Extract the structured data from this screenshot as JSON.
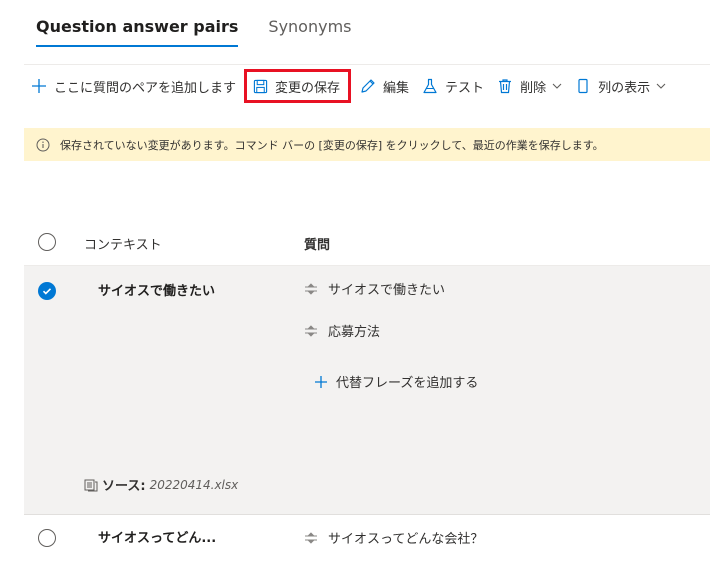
{
  "tabs": [
    {
      "label": "Question answer pairs",
      "active": true
    },
    {
      "label": "Synonyms",
      "active": false
    }
  ],
  "toolbar": {
    "add_label": "ここに質問のペアを追加します",
    "save_label": "変更の保存",
    "edit_label": "編集",
    "test_label": "テスト",
    "delete_label": "削除",
    "columns_label": "列の表示"
  },
  "banner": {
    "message": "保存されていない変更があります。コマンド バーの [変更の保存] をクリックして、最近の作業を保存します。",
    "background": "#fff4ce"
  },
  "table": {
    "headers": {
      "context": "コンテキスト",
      "question": "質問"
    },
    "rows": [
      {
        "selected": true,
        "context": "サイオスで働きたい",
        "questions": [
          "サイオスで働きたい",
          "応募方法"
        ],
        "add_alt_label": "代替フレーズを追加する",
        "source_label": "ソース:",
        "source_file": "20220414.xlsx"
      },
      {
        "selected": false,
        "context": "サイオスってどん...",
        "questions": [
          "サイオスってどんな会社？"
        ]
      }
    ]
  },
  "colors": {
    "accent": "#0078d4",
    "highlight_border": "#e81123",
    "selected_row": "#f3f2f1"
  },
  "icons": [
    "plus-icon",
    "save-icon",
    "pencil-icon",
    "flask-icon",
    "trash-icon",
    "chevron-down-icon",
    "column-icon",
    "info-icon",
    "grip-icon",
    "document-icon",
    "checkmark-icon"
  ]
}
